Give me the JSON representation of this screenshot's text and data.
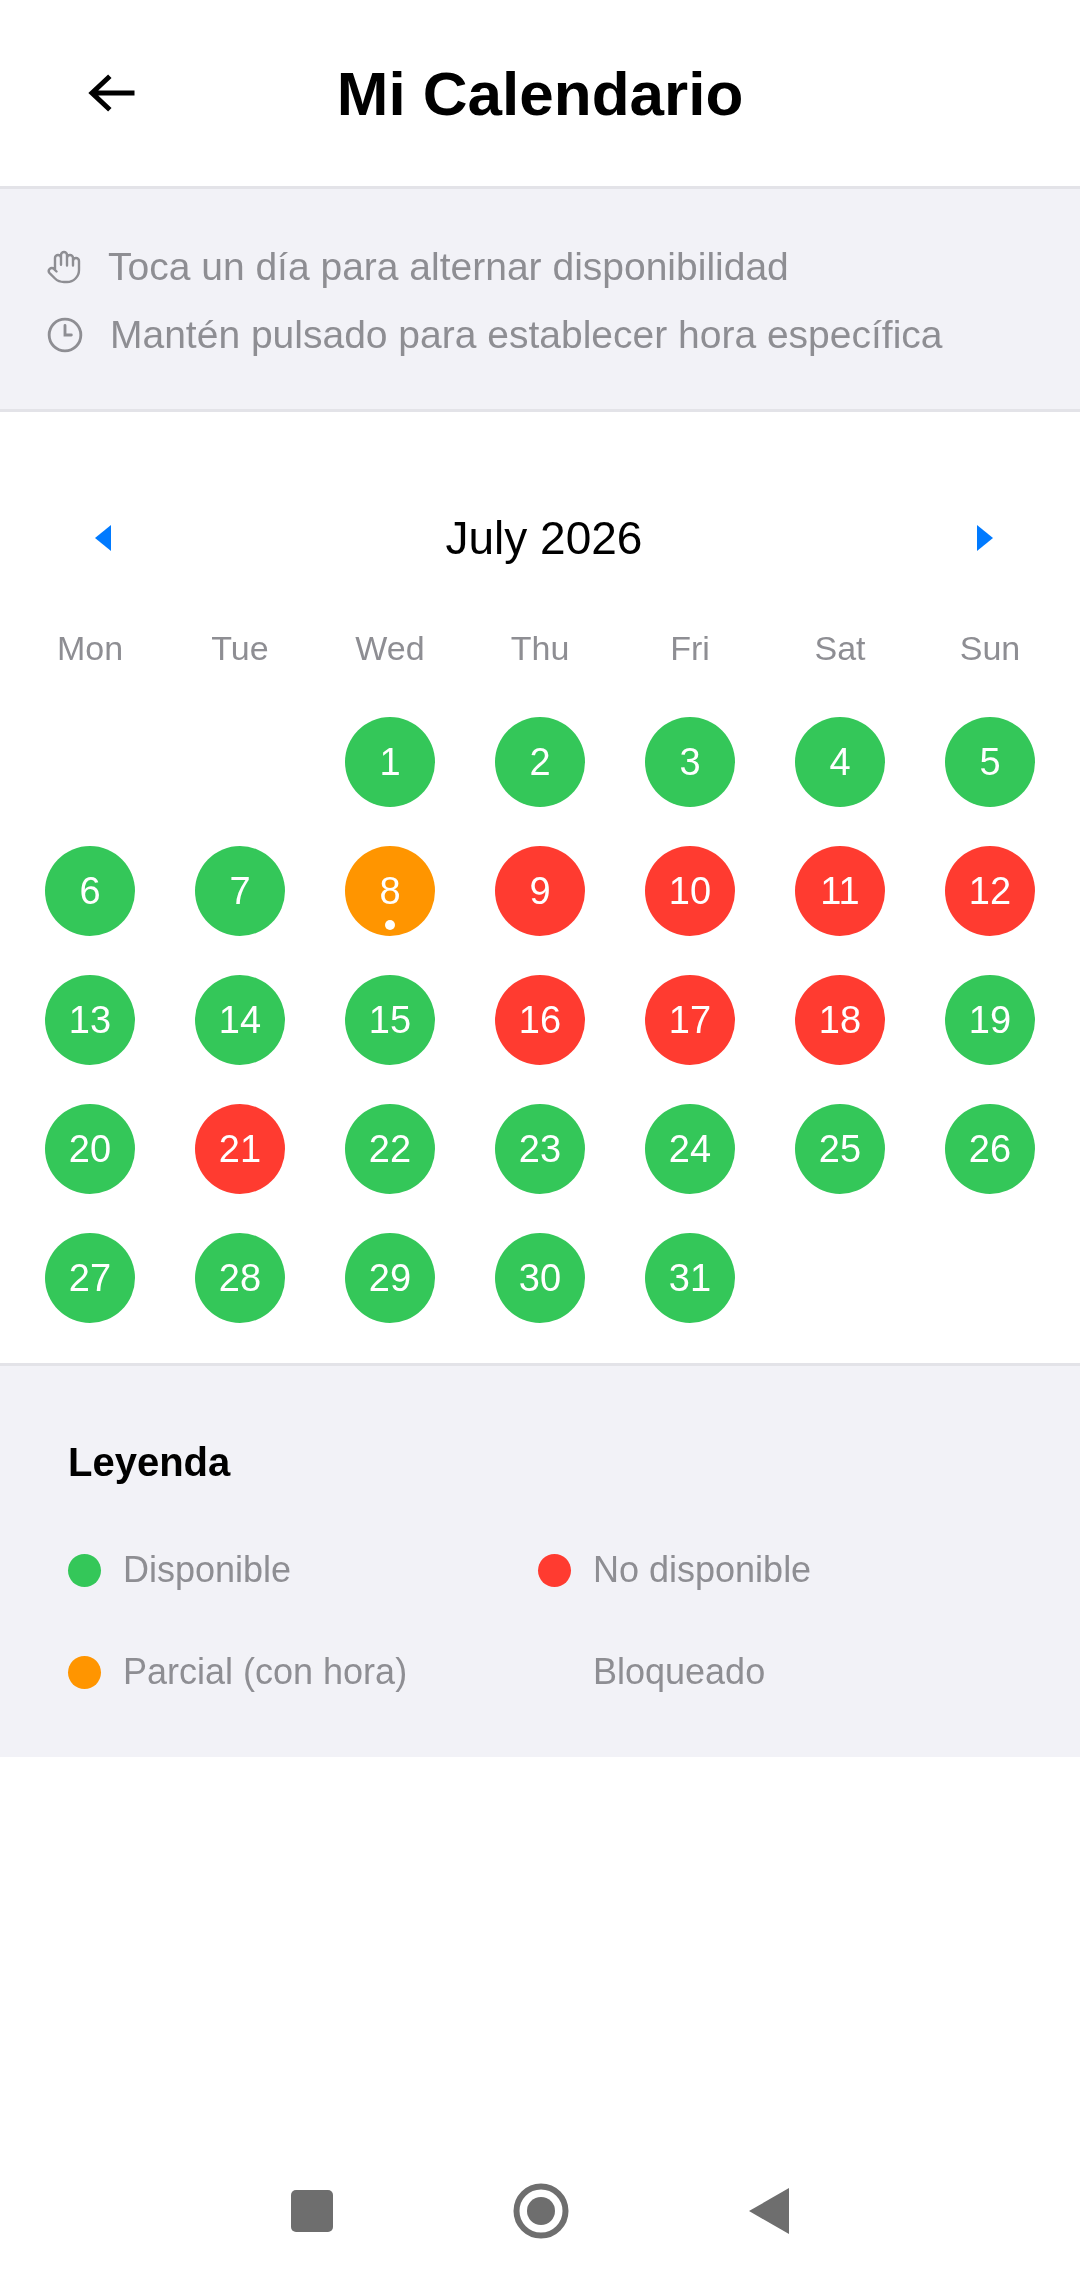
{
  "header": {
    "title": "Mi Calendario"
  },
  "hints": [
    {
      "kind": "hand",
      "text": "Toca un día para alternar disponibilidad"
    },
    {
      "kind": "clock",
      "text": "Mantén pulsado para establecer hora específica"
    }
  ],
  "calendar": {
    "month": "July 2026",
    "weekdays": [
      "Mon",
      "Tue",
      "Wed",
      "Thu",
      "Fri",
      "Sat",
      "Sun"
    ],
    "weeks": [
      [
        {
          "kind": "blank"
        },
        {
          "kind": "blank"
        },
        {
          "day": "1",
          "color": "#34c759",
          "marked": false
        },
        {
          "day": "2",
          "color": "#34c759",
          "marked": false
        },
        {
          "day": "3",
          "color": "#34c759",
          "marked": false
        },
        {
          "day": "4",
          "color": "#34c759",
          "marked": false
        },
        {
          "day": "5",
          "color": "#34c759",
          "marked": false
        }
      ],
      [
        {
          "day": "6",
          "color": "#34c759",
          "marked": false
        },
        {
          "day": "7",
          "color": "#34c759",
          "marked": false
        },
        {
          "day": "8",
          "color": "#ff9500",
          "marked": true
        },
        {
          "day": "9",
          "color": "#ff3b30",
          "marked": false
        },
        {
          "day": "10",
          "color": "#ff3b30",
          "marked": false
        },
        {
          "day": "11",
          "color": "#ff3b30",
          "marked": false
        },
        {
          "day": "12",
          "color": "#ff3b30",
          "marked": false
        }
      ],
      [
        {
          "day": "13",
          "color": "#34c759",
          "marked": false
        },
        {
          "day": "14",
          "color": "#34c759",
          "marked": false
        },
        {
          "day": "15",
          "color": "#34c759",
          "marked": false
        },
        {
          "day": "16",
          "color": "#ff3b30",
          "marked": false
        },
        {
          "day": "17",
          "color": "#ff3b30",
          "marked": false
        },
        {
          "day": "18",
          "color": "#ff3b30",
          "marked": false
        },
        {
          "day": "19",
          "color": "#34c759",
          "marked": false
        }
      ],
      [
        {
          "day": "20",
          "color": "#34c759",
          "marked": false
        },
        {
          "day": "21",
          "color": "#ff3b30",
          "marked": false
        },
        {
          "day": "22",
          "color": "#34c759",
          "marked": false
        },
        {
          "day": "23",
          "color": "#34c759",
          "marked": false
        },
        {
          "day": "24",
          "color": "#34c759",
          "marked": false
        },
        {
          "day": "25",
          "color": "#34c759",
          "marked": false
        },
        {
          "day": "26",
          "color": "#34c759",
          "marked": false
        }
      ],
      [
        {
          "day": "27",
          "color": "#34c759",
          "marked": false
        },
        {
          "day": "28",
          "color": "#34c759",
          "marked": false
        },
        {
          "day": "29",
          "color": "#34c759",
          "marked": false
        },
        {
          "day": "30",
          "color": "#34c759",
          "marked": false
        },
        {
          "day": "31",
          "color": "#34c759",
          "marked": false
        },
        {
          "kind": "blank"
        },
        {
          "kind": "blank"
        }
      ]
    ]
  },
  "legend": {
    "title": "Leyenda",
    "items": [
      {
        "label": "Disponible",
        "color": "#34c759"
      },
      {
        "label": "No disponible",
        "color": "#ff3b30"
      },
      {
        "label": "Parcial (con hora)",
        "color": "#ff9500"
      },
      {
        "label": "Bloqueado"
      }
    ]
  }
}
